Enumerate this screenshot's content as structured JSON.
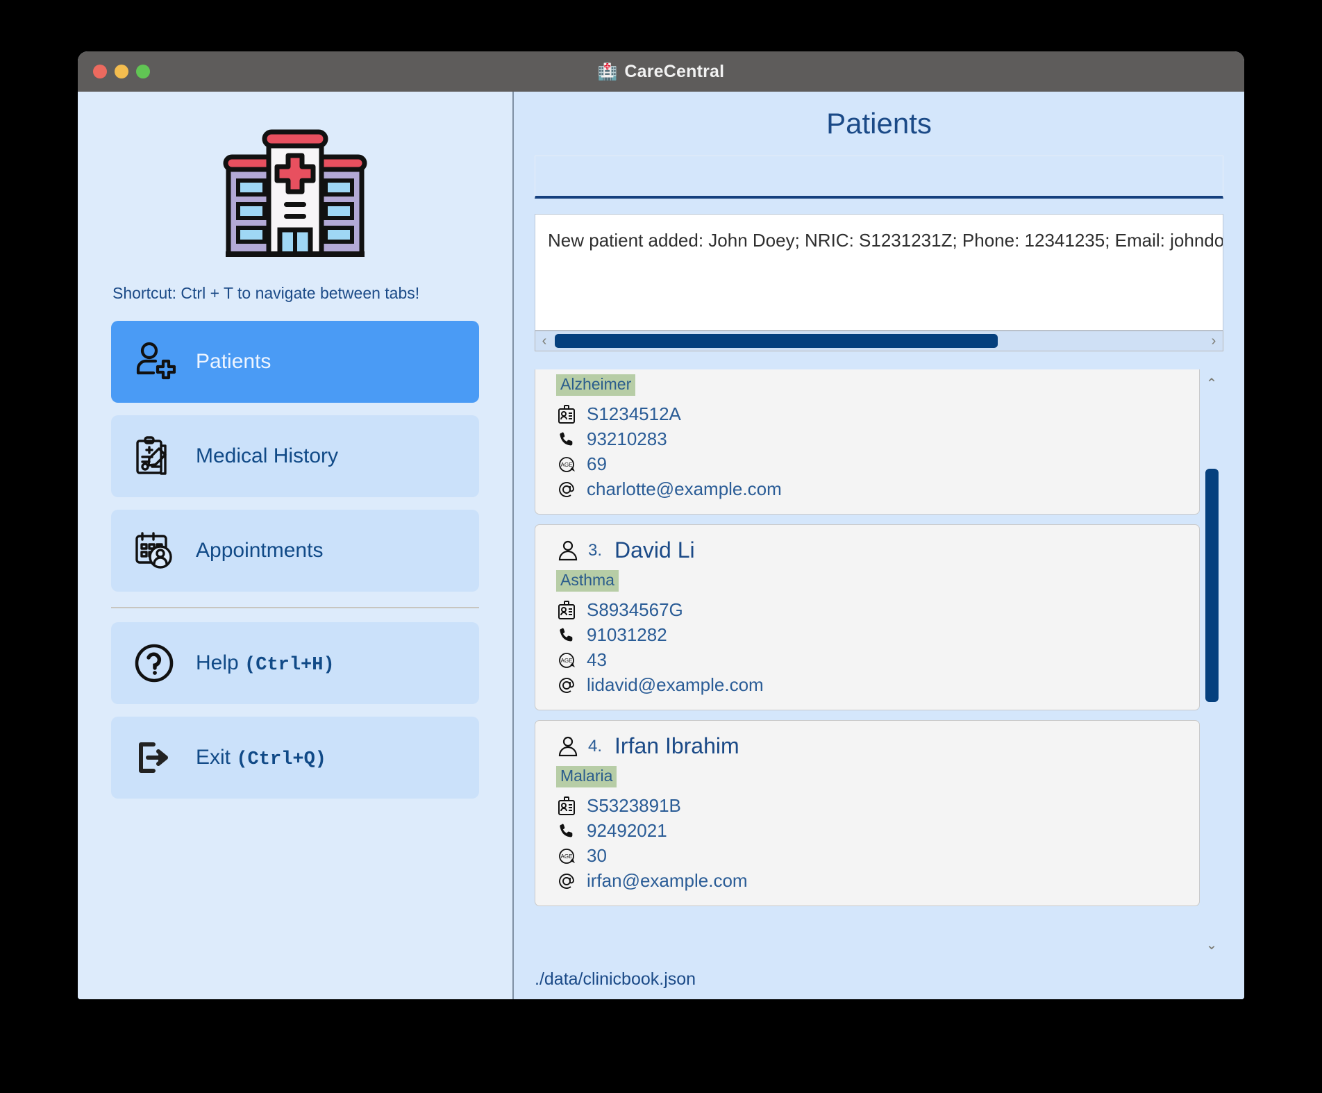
{
  "window": {
    "title": "CareCentral",
    "title_icon": "hospital-icon",
    "traffic_lights": [
      "close",
      "minimize",
      "maximize"
    ]
  },
  "sidebar": {
    "logo_icon": "hospital-building-logo",
    "shortcut_hint": "Shortcut: Ctrl + T to navigate between tabs!",
    "items": [
      {
        "label": "Patients",
        "icon": "add-person-icon",
        "active": true
      },
      {
        "label": "Medical History",
        "icon": "clipboard-pencil-icon",
        "active": false
      },
      {
        "label": "Appointments",
        "icon": "calendar-person-icon",
        "active": false
      }
    ],
    "actions": [
      {
        "label": "Help",
        "shortcut": "(Ctrl+H)",
        "icon": "question-circle-icon"
      },
      {
        "label": "Exit",
        "shortcut": "(Ctrl+Q)",
        "icon": "exit-arrow-icon"
      }
    ]
  },
  "main": {
    "page_title": "Patients",
    "command_input": {
      "value": "",
      "placeholder": ""
    },
    "result_message": "New patient added: John Doey; NRIC: S1231231Z; Phone: 12341235; Email: johndo",
    "hscroll": {
      "left_arrow": "‹",
      "right_arrow": "›"
    },
    "vscroll": {
      "up_arrow": "⌃",
      "down_arrow": "⌄"
    },
    "patients": [
      {
        "index": "",
        "name": "",
        "tag": "Alzheimer",
        "nric": "S1234512A",
        "phone": "93210283",
        "age": "69",
        "email": "charlotte@example.com",
        "partial": true
      },
      {
        "index": "3.",
        "name": "David Li",
        "tag": "Asthma",
        "nric": "S8934567G",
        "phone": "91031282",
        "age": "43",
        "email": "lidavid@example.com",
        "partial": false
      },
      {
        "index": "4.",
        "name": "Irfan Ibrahim",
        "tag": "Malaria",
        "nric": "S5323891B",
        "phone": "92492021",
        "age": "30",
        "email": "irfan@example.com",
        "partial": false
      }
    ]
  },
  "statusbar": {
    "file_path": "./data/clinicbook.json"
  },
  "colors": {
    "accent_blue": "#4a9bf5",
    "deep_blue": "#1b4a87",
    "scrollbar": "#05407e",
    "tag_green": "#b7cda6",
    "sidebar_bg": "#ddebfb",
    "main_bg": "#d4e6fb",
    "titlebar": "#5e5c5b"
  }
}
